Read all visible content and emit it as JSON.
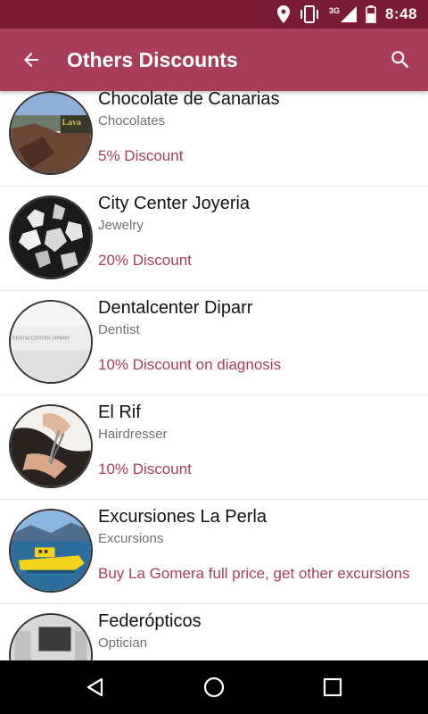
{
  "status_bar": {
    "time": "8:48",
    "network": "3G",
    "icons": [
      "location-icon",
      "vibrate-icon",
      "signal-icon",
      "battery-icon"
    ]
  },
  "app_bar": {
    "title": "Others Discounts",
    "back_icon": "arrow-back-icon",
    "search_icon": "search-icon"
  },
  "colors": {
    "status_bar": "#7a1c35",
    "app_bar": "#a83d5a",
    "discount_text": "#a83d5a"
  },
  "items": [
    {
      "name": "Chocolate de Canarias",
      "category": "Chocolates",
      "discount": "5% Discount",
      "thumb_text": "Lava"
    },
    {
      "name": "City Center Joyeria",
      "category": "Jewelry",
      "discount": "20% Discount"
    },
    {
      "name": "Dentalcenter Diparr",
      "category": "Dentist",
      "discount": "10% Discount on diagnosis",
      "thumb_text": "DENTALCENTER DIPARR"
    },
    {
      "name": "El Rif",
      "category": "Hairdresser",
      "discount": "10% Discount"
    },
    {
      "name": "Excursiones La Perla",
      "category": "Excursions",
      "discount": "Buy La Gomera full price, get other excursions"
    },
    {
      "name": "Federópticos",
      "category": "Optician",
      "discount": ""
    }
  ],
  "nav_bar": {
    "back": "nav-back-icon",
    "home": "nav-home-icon",
    "recents": "nav-recents-icon"
  }
}
